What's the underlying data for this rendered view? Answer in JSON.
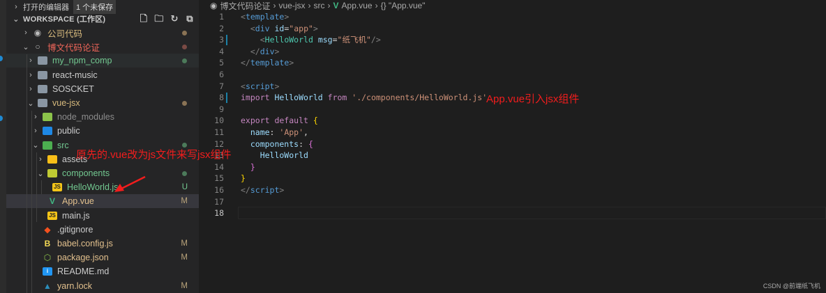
{
  "sidebar": {
    "open_editors": {
      "label": "打开的编辑器",
      "badge": "1 个未保存"
    },
    "workspace": {
      "label": "WORKSPACE (工作区)",
      "actions": [
        "new-file-icon",
        "new-folder-icon",
        "refresh-icon",
        "collapse-all-icon"
      ]
    },
    "tree": [
      {
        "label": "公司代码",
        "depth": 0,
        "chev": "›",
        "icon": "radio-on-icon",
        "color": "#d7ba7d",
        "dot": "#8a7355"
      },
      {
        "label": "博文代码论证",
        "depth": 0,
        "chev": "⌄",
        "icon": "radio-off-icon",
        "color": "#f0665a",
        "dot": "#7a4a44"
      },
      {
        "label": "my_npm_comp",
        "depth": 1,
        "chev": "›",
        "icon": "folder-icon",
        "color": "#73c991",
        "dot": "#4c7a5a",
        "hl": true
      },
      {
        "label": "react-music",
        "depth": 1,
        "chev": "›",
        "icon": "folder-icon",
        "color": "#cccccc"
      },
      {
        "label": "SOSCKET",
        "depth": 1,
        "chev": "›",
        "icon": "folder-icon",
        "color": "#cccccc"
      },
      {
        "label": "vue-jsx",
        "depth": 1,
        "chev": "⌄",
        "icon": "folder-open-icon",
        "color": "#d7ba7d",
        "dot": "#8a7355"
      },
      {
        "label": "node_modules",
        "depth": 2,
        "chev": "›",
        "icon": "node-folder-icon",
        "color": "#8c8c8c"
      },
      {
        "label": "public",
        "depth": 2,
        "chev": "›",
        "icon": "public-folder-icon",
        "color": "#cccccc"
      },
      {
        "label": "src",
        "depth": 2,
        "chev": "⌄",
        "icon": "src-folder-icon",
        "color": "#73c991",
        "dot": "#4c7a5a"
      },
      {
        "label": "assets",
        "depth": 3,
        "chev": "›",
        "icon": "assets-folder-icon",
        "color": "#cccccc"
      },
      {
        "label": "components",
        "depth": 3,
        "chev": "⌄",
        "icon": "components-folder-icon",
        "color": "#73c991",
        "dot": "#4c7a5a"
      },
      {
        "label": "HelloWorld.js",
        "depth": 4,
        "chev": "",
        "icon": "js-file-icon",
        "color": "#73c991",
        "status": "U",
        "statusColor": "#73c991"
      },
      {
        "label": "App.vue",
        "depth": 3,
        "chev": "",
        "icon": "vue-file-icon",
        "color": "#e2c08d",
        "status": "M",
        "sel": true
      },
      {
        "label": "main.js",
        "depth": 3,
        "chev": "",
        "icon": "js-file-icon",
        "color": "#cccccc"
      },
      {
        "label": ".gitignore",
        "depth": 2,
        "chev": "",
        "icon": "git-icon",
        "color": "#cccccc"
      },
      {
        "label": "babel.config.js",
        "depth": 2,
        "chev": "",
        "icon": "babel-icon",
        "color": "#e2c08d",
        "status": "M"
      },
      {
        "label": "package.json",
        "depth": 2,
        "chev": "",
        "icon": "nodejs-icon",
        "color": "#e2c08d",
        "status": "M"
      },
      {
        "label": "README.md",
        "depth": 2,
        "chev": "",
        "icon": "info-icon",
        "color": "#cccccc"
      },
      {
        "label": "yarn.lock",
        "depth": 2,
        "chev": "",
        "icon": "yarn-icon",
        "color": "#e2c08d",
        "status": "M"
      }
    ]
  },
  "editor": {
    "breadcrumb": [
      "博文代码论证",
      "vue-jsx",
      "src",
      "App.vue",
      "{} \"App.vue\""
    ],
    "lines": [
      [
        [
          "<",
          "p"
        ],
        [
          "template",
          "tag"
        ],
        [
          ">",
          "p"
        ]
      ],
      [
        [
          "  ",
          "tx"
        ],
        [
          "<",
          "p"
        ],
        [
          "div",
          "tag"
        ],
        [
          " id",
          "attr"
        ],
        [
          "=",
          "tx"
        ],
        [
          "\"app\"",
          "str"
        ],
        [
          ">",
          "p"
        ]
      ],
      [
        [
          "    ",
          "tx"
        ],
        [
          "<",
          "p"
        ],
        [
          "HelloWorld",
          "comp"
        ],
        [
          " msg",
          "attr"
        ],
        [
          "=",
          "tx"
        ],
        [
          "\"纸飞机\"",
          "str"
        ],
        [
          "/>",
          "p"
        ]
      ],
      [
        [
          "  ",
          "tx"
        ],
        [
          "</",
          "p"
        ],
        [
          "div",
          "tag"
        ],
        [
          ">",
          "p"
        ]
      ],
      [
        [
          "</",
          "p"
        ],
        [
          "template",
          "tag"
        ],
        [
          ">",
          "p"
        ]
      ],
      [],
      [
        [
          "<",
          "p"
        ],
        [
          "script",
          "tag"
        ],
        [
          ">",
          "p"
        ]
      ],
      [
        [
          "import",
          "kw"
        ],
        [
          " HelloWorld ",
          "id"
        ],
        [
          "from",
          "kw"
        ],
        [
          " './components/HelloWorld.js'",
          "str"
        ]
      ],
      [],
      [
        [
          "export default ",
          "kw"
        ],
        [
          "{",
          "b1"
        ]
      ],
      [
        [
          "  name",
          "id"
        ],
        [
          ": ",
          "tx"
        ],
        [
          "'App'",
          "str"
        ],
        [
          ",",
          "tx"
        ]
      ],
      [
        [
          "  components",
          "id"
        ],
        [
          ": ",
          "tx"
        ],
        [
          "{",
          "b2"
        ]
      ],
      [
        [
          "    HelloWorld",
          "id"
        ]
      ],
      [
        [
          "  ",
          "tx"
        ],
        [
          "}",
          "b2"
        ]
      ],
      [
        [
          "}",
          "b1"
        ]
      ],
      [
        [
          "</",
          "p"
        ],
        [
          "script",
          "tag"
        ],
        [
          ">",
          "p"
        ]
      ],
      [],
      []
    ],
    "modified_lines": [
      3,
      8
    ]
  },
  "annotations": {
    "import_note": "App.vue引入jsx组件",
    "file_note": "原先的.vue改为js文件来写jsx组件"
  },
  "watermark": "CSDN @前端纸飞机",
  "colors": {
    "annotation": "#f21d1d",
    "accent": "#1b81a8"
  }
}
